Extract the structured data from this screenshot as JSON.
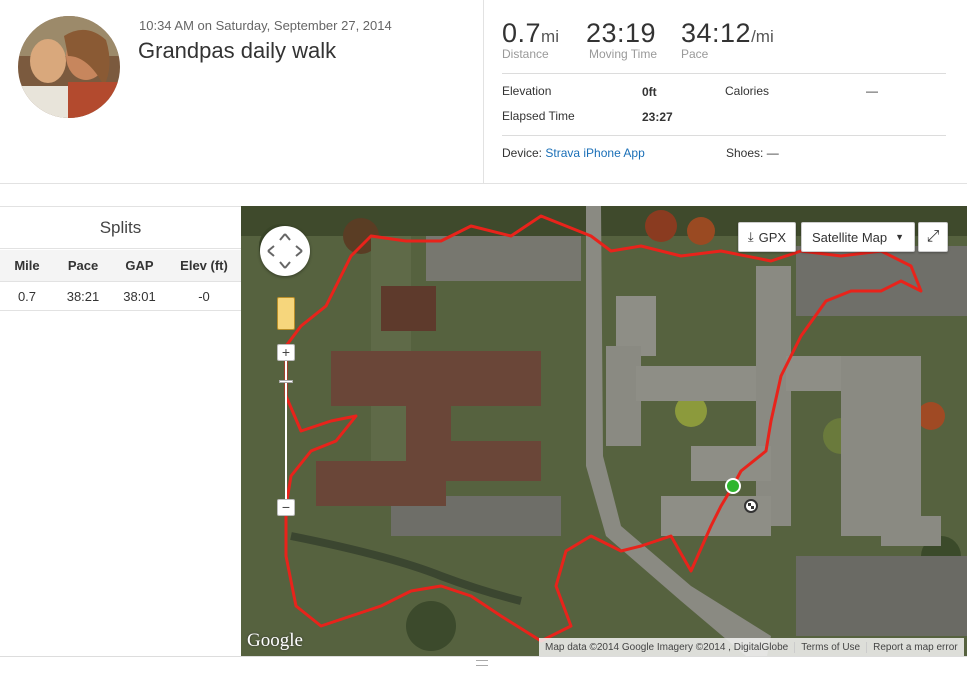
{
  "activity": {
    "time": "10:34 AM on Saturday, September 27, 2014",
    "title": "Grandpas daily walk"
  },
  "stats": {
    "distance": {
      "value": "0.7",
      "unit": "mi",
      "label": "Distance"
    },
    "moving_time": {
      "value": "23:19",
      "label": "Moving Time"
    },
    "pace": {
      "value": "34:12",
      "unit": "/mi",
      "label": "Pace"
    },
    "elevation": {
      "label": "Elevation",
      "value": "0ft"
    },
    "calories": {
      "label": "Calories",
      "value": "—"
    },
    "elapsed_time": {
      "label": "Elapsed Time",
      "value": "23:27"
    },
    "device": {
      "label": "Device:",
      "value": "Strava iPhone App"
    },
    "shoes": {
      "label": "Shoes:",
      "value": "—"
    }
  },
  "splits": {
    "title": "Splits",
    "columns": [
      "Mile",
      "Pace",
      "GAP",
      "Elev (ft)"
    ],
    "rows": [
      [
        "0.7",
        "38:21",
        "38:01",
        "-0"
      ]
    ]
  },
  "map": {
    "gpx_label": "GPX",
    "map_type": "Satellite Map",
    "google_label": "Google",
    "attribution": "Map data ©2014 Google Imagery ©2014 , DigitalGlobe",
    "terms": "Terms of Use",
    "report": "Report a map error",
    "route_color": "#e8231b",
    "start_color": "#2fb62f"
  }
}
